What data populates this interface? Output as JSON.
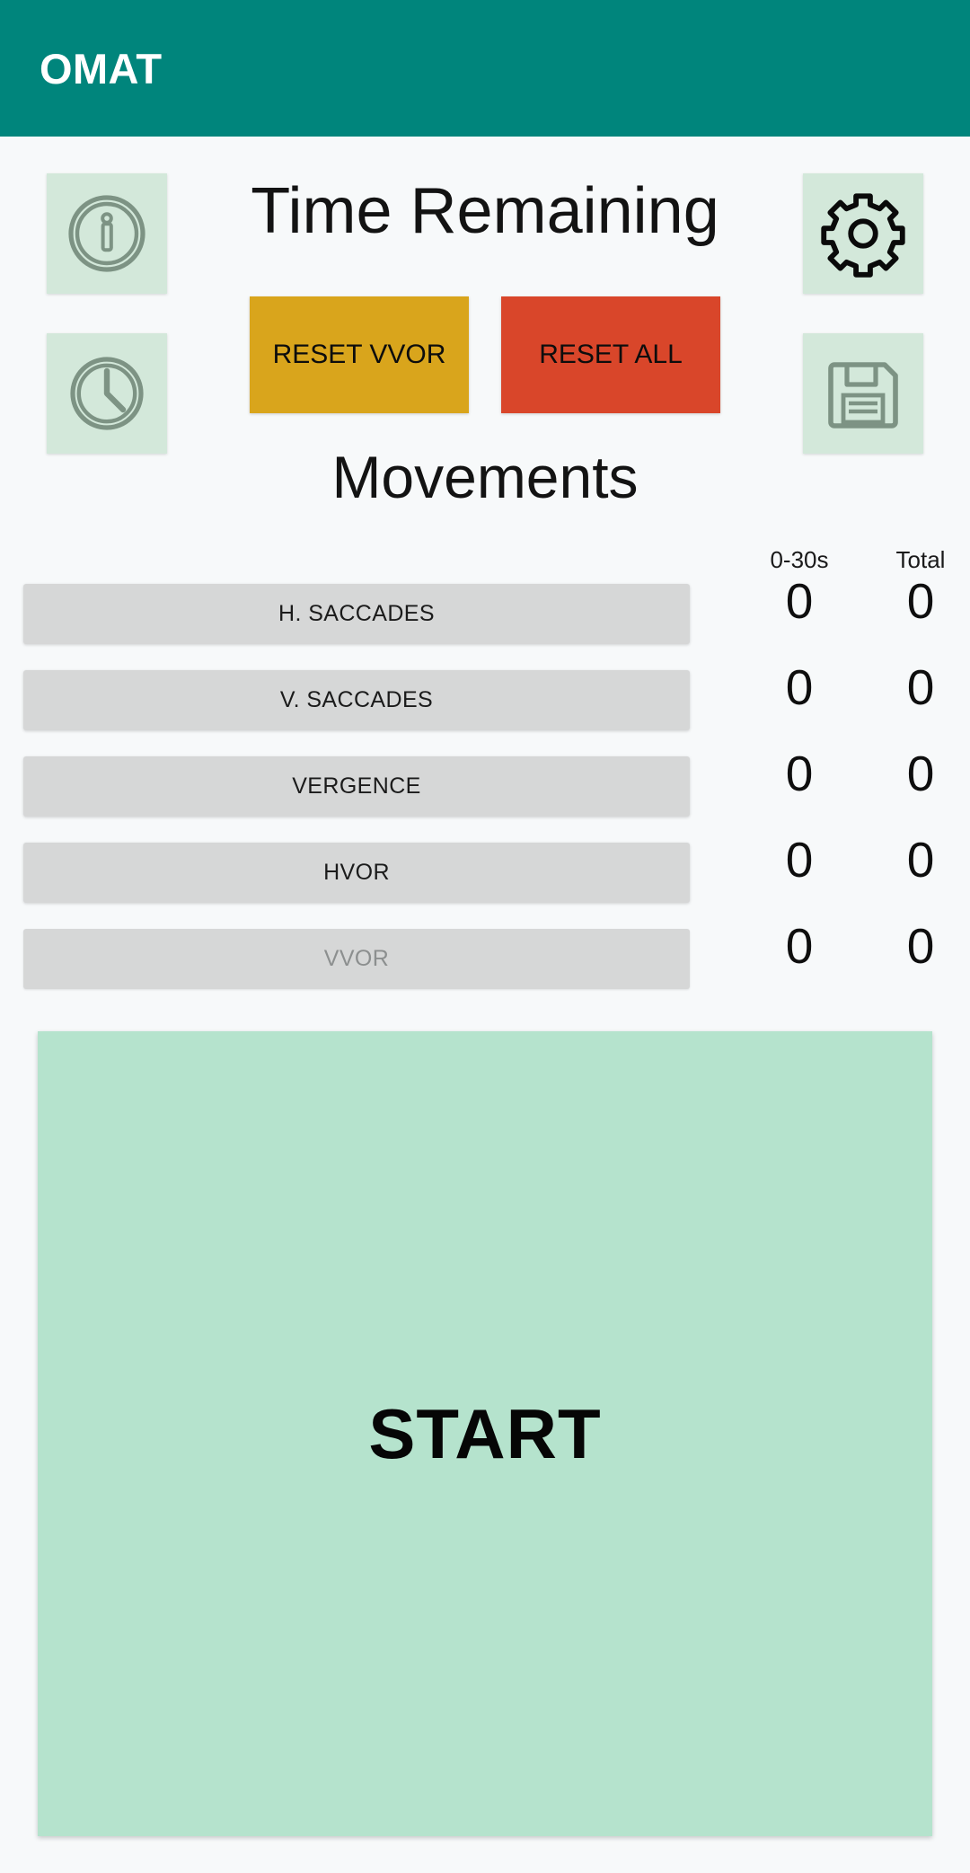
{
  "appbar": {
    "title": "OMAT"
  },
  "icons": {
    "info": "info-circle-icon",
    "clock": "clock-icon",
    "gear": "gear-icon",
    "save": "floppy-disk-save-icon"
  },
  "headings": {
    "time_remaining": "Time Remaining",
    "movements": "Movements"
  },
  "reset": {
    "vvor_label": "RESET VVOR",
    "all_label": "RESET ALL",
    "vvor_color": "#d9a51c",
    "all_color": "#d9462a"
  },
  "table": {
    "columns": [
      "0-30s",
      "Total"
    ],
    "rows": [
      {
        "label": "H. SACCADES",
        "short": 0,
        "total": 0,
        "enabled": true
      },
      {
        "label": "V. SACCADES",
        "short": 0,
        "total": 0,
        "enabled": true
      },
      {
        "label": "VERGENCE",
        "short": 0,
        "total": 0,
        "enabled": true
      },
      {
        "label": "HVOR",
        "short": 0,
        "total": 0,
        "enabled": true
      },
      {
        "label": "VVOR",
        "short": 0,
        "total": 0,
        "enabled": false
      }
    ]
  },
  "start": {
    "label": "START",
    "color": "#b5e3cd"
  },
  "theme": {
    "appbar": "#00857c",
    "page_background": "#f7f9fa",
    "icon_button_background": "#d3e8da",
    "movement_button": "#d6d7d7"
  }
}
